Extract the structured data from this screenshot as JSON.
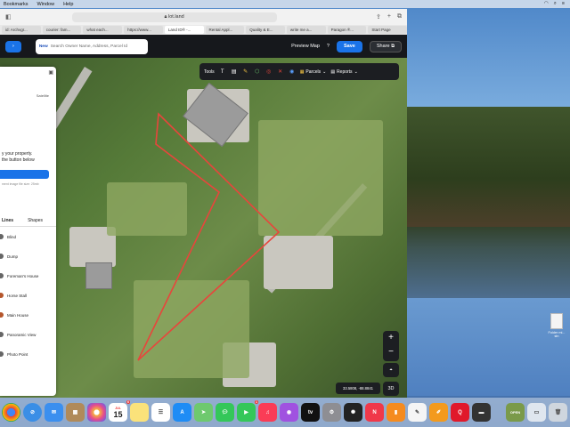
{
  "menubar": {
    "items": [
      "Bookmarks",
      "Window",
      "Help"
    ]
  },
  "browser": {
    "url": "lot.land",
    "tabs": [
      {
        "label": "id: Archvgr...",
        "active": false
      },
      {
        "label": "courier: fam...",
        "active": false
      },
      {
        "label": "what each...",
        "active": false
      },
      {
        "label": "https://www...",
        "active": false
      },
      {
        "label": "Land ID® -...",
        "active": true
      },
      {
        "label": "Rental Appl...",
        "active": false
      },
      {
        "label": "Quality & E...",
        "active": false
      },
      {
        "label": "write me a...",
        "active": false
      },
      {
        "label": "Paragon ®...",
        "active": false
      },
      {
        "label": "Start Page",
        "active": false
      }
    ]
  },
  "appbar": {
    "new_label": "New",
    "search_placeholder": "Search Owner Name, Address, Parcel Id",
    "preview_label": "Preview Map",
    "help_label": "?",
    "save_label": "Save",
    "share_label": "Share"
  },
  "maptools": {
    "tools_label": "Tools",
    "parcels_label": "Parcels",
    "reports_label": "Reports"
  },
  "panel": {
    "satellite_label": "Satellite",
    "prompt_line1": "y your property.",
    "prompt_line2": "the button below",
    "note": "ment image file size: 25mb",
    "tab_lines": "Lines",
    "tab_shapes": "Shapes",
    "items": [
      "Blind",
      "Dump",
      "Foreman's House",
      "Horse Stall",
      "Main House",
      "Panoramic View",
      "Photo Point"
    ]
  },
  "map": {
    "coords": "33.5808, -88.8841",
    "zoom_in": "+",
    "zoom_out": "−",
    "btn_3d": "3D",
    "parcel_color": "#e8453c"
  },
  "desktop": {
    "file_label_1": "Folder mi...",
    "file_label_2": "stn"
  },
  "dock": {
    "calendar_month": "JUL",
    "calendar_day": "15",
    "calendar_badge": "",
    "apps": [
      "finder-icon",
      "chrome-icon",
      "safari-icon",
      "mail-icon",
      "archive-icon",
      "photos-icon",
      "calendar-icon",
      "notes-icon",
      "reminders-icon",
      "appstore-icon",
      "maps-icon",
      "messages-icon",
      "facetime-icon",
      "music-icon",
      "podcasts-icon",
      "tv-icon",
      "settings-icon",
      "chatgpt-icon",
      "news-icon",
      "books-icon",
      "textedit-icon",
      "pages-icon",
      "rakuten-icon",
      "store-icon",
      "open-icon",
      "preview-icon",
      "trash-icon"
    ],
    "badge_messages": "1",
    "badge_calendar": "6"
  }
}
